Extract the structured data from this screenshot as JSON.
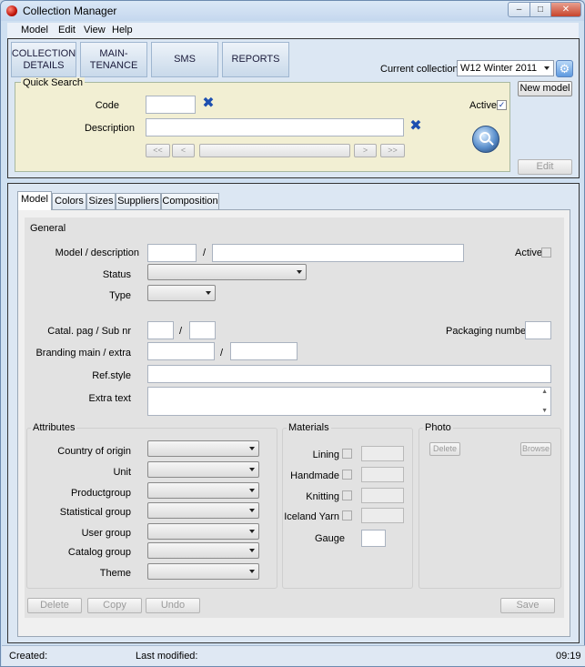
{
  "window": {
    "title": "Collection Manager",
    "minimize": "–",
    "maximize": "□",
    "close": "✕"
  },
  "menu": [
    "Model",
    "Edit",
    "View",
    "Help"
  ],
  "nav": {
    "collection_details_1": "COLLECTION",
    "collection_details_2": "DETAILS",
    "maintenance_1": "MAIN-",
    "maintenance_2": "TENANCE",
    "sms": "SMS",
    "reports": "REPORTS"
  },
  "current_collection": {
    "label": "Current collection",
    "value": "W12  Winter 2011",
    "gear": "⚙"
  },
  "quick_search": {
    "title": "Quick Search",
    "code_label": "Code",
    "description_label": "Description",
    "active_label": "Active",
    "active_check": "✓",
    "clear": "✖",
    "first": "<<",
    "prev": "<",
    "next": ">",
    "last": ">>"
  },
  "side_buttons": {
    "new_model": "New model",
    "edit": "Edit"
  },
  "tabs": [
    "Model",
    "Colors",
    "Sizes",
    "Suppliers",
    "Composition"
  ],
  "general": {
    "title": "General",
    "model_description": "Model / description",
    "slash": "/",
    "active": "Active",
    "status": "Status",
    "type": "Type",
    "catal": "Catal. pag / Sub nr",
    "packaging": "Packaging number",
    "branding": "Branding main / extra",
    "refstyle": "Ref.style",
    "extra_text": "Extra text"
  },
  "attributes": {
    "title": "Attributes",
    "labels": [
      "Country of origin",
      "Unit",
      "Productgroup",
      "Statistical group",
      "User group",
      "Catalog group",
      "Theme"
    ]
  },
  "materials": {
    "title": "Materials",
    "labels": [
      "Lining",
      "Handmade",
      "Knitting",
      "Iceland Yarn"
    ],
    "gauge": "Gauge"
  },
  "photo": {
    "title": "Photo",
    "delete": "Delete",
    "browse": "Browse"
  },
  "actions": {
    "delete": "Delete",
    "copy": "Copy",
    "undo": "Undo",
    "save": "Save"
  },
  "status": {
    "created": "Created:",
    "modified": "Last modified:",
    "time": "09:19"
  }
}
